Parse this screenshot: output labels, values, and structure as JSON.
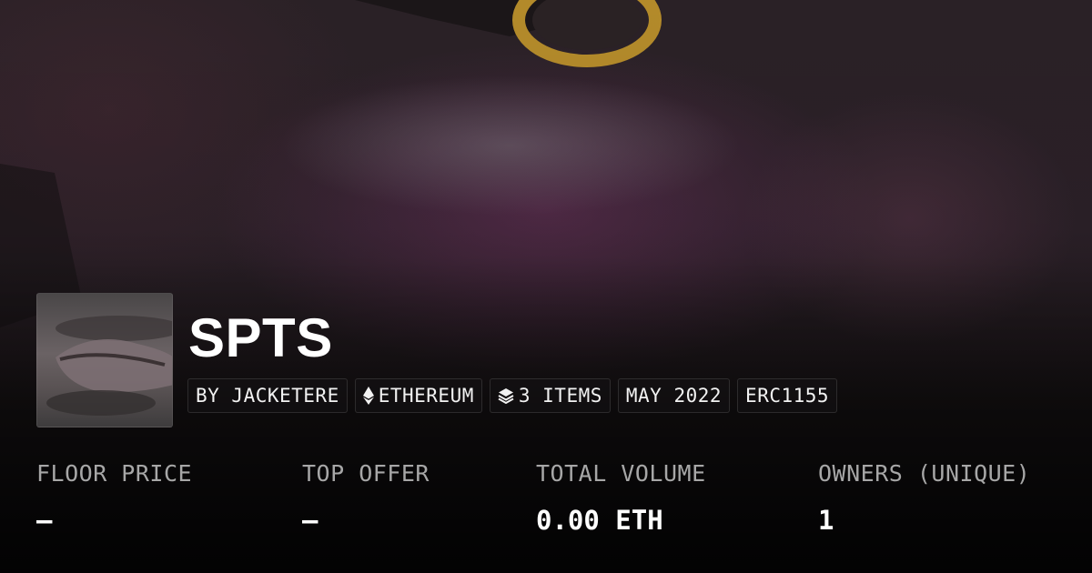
{
  "collection": {
    "title": "SPTS",
    "badges": [
      {
        "label": "BY JACKETERE",
        "icon": ""
      },
      {
        "label": "ETHEREUM",
        "icon": "ethereum-icon"
      },
      {
        "label": "3 ITEMS",
        "icon": "layers-icon"
      },
      {
        "label": "MAY 2022",
        "icon": ""
      },
      {
        "label": "ERC1155",
        "icon": ""
      }
    ]
  },
  "stats": [
    {
      "label": "FLOOR PRICE",
      "value": "—"
    },
    {
      "label": "TOP OFFER",
      "value": "—"
    },
    {
      "label": "TOTAL VOLUME",
      "value": "0.00 ETH"
    },
    {
      "label": "OWNERS (UNIQUE)",
      "value": "1"
    }
  ],
  "colors": {
    "background": "#141113",
    "text_primary": "#ffffff",
    "text_secondary": "#a7a7a7",
    "accent_gold": "#c9a23a"
  }
}
